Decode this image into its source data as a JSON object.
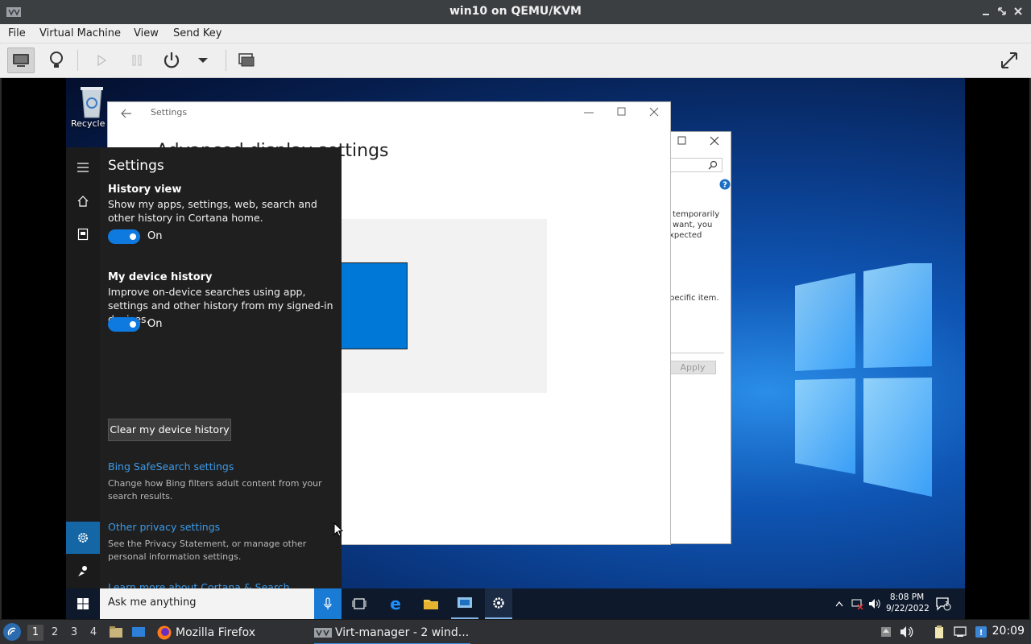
{
  "host": {
    "window_title": "win10 on QEMU/KVM",
    "menu": [
      "File",
      "Virtual Machine",
      "View",
      "Send Key"
    ]
  },
  "desktop": {
    "recycle_bin_label": "Recycle Bin"
  },
  "settings_window": {
    "title": "Settings",
    "heading": "Advanced display settings"
  },
  "back_window": {
    "lines": [
      "temporarily",
      "want, you",
      "xpected",
      "pecific item."
    ],
    "apply_label": "Apply"
  },
  "cortana": {
    "title": "Settings",
    "history_view": {
      "heading": "History view",
      "description": "Show my apps, settings, web, search and other history in Cortana home.",
      "toggle_label": "On"
    },
    "device_history": {
      "heading": "My device history",
      "description": "Improve on-device searches using app, settings and other history from my signed-in devices.",
      "toggle_label": "On",
      "clear_button": "Clear my device history"
    },
    "bing": {
      "link": "Bing SafeSearch settings",
      "description": "Change how Bing filters adult content from your search results."
    },
    "privacy": {
      "link": "Other privacy settings",
      "description": "See the Privacy Statement, or manage other personal information settings."
    },
    "learn_more": "Learn more about Cortana & Search"
  },
  "win_taskbar": {
    "search_placeholder": "Ask me anything",
    "time": "8:08 PM",
    "date": "9/22/2022",
    "notification_count": "1"
  },
  "host_panel": {
    "workspaces": [
      "1",
      "2",
      "3",
      "4"
    ],
    "tasks": [
      {
        "label": "Mozilla Firefox"
      },
      {
        "label": "Virt-manager - 2 wind..."
      }
    ],
    "time": "20:09"
  },
  "colors": {
    "accent": "#0078d7",
    "cortana_bg": "#1f1f1f",
    "link": "#3d9ae8"
  }
}
